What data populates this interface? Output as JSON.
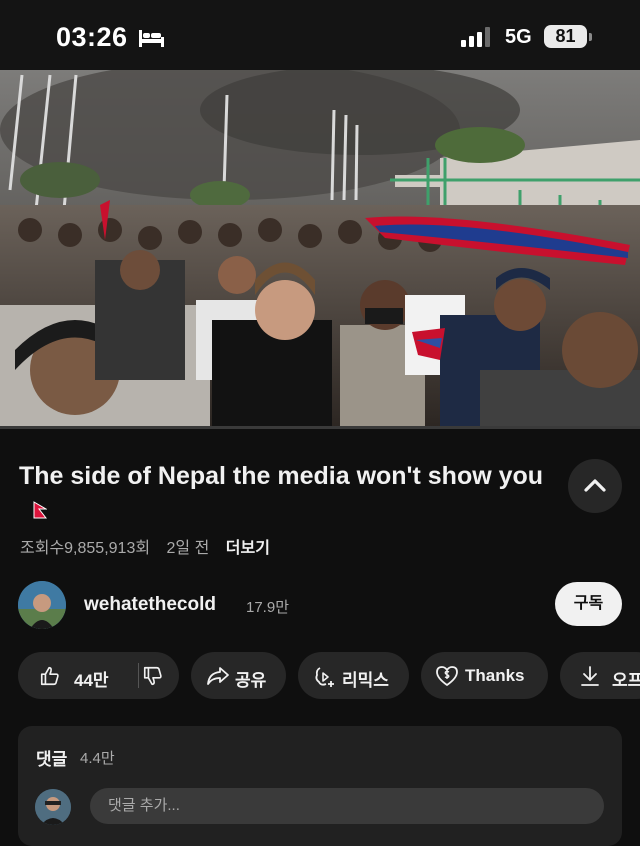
{
  "status_bar": {
    "time": "03:26",
    "network": "5G",
    "battery": "81",
    "icons": [
      "sleep-mode-icon",
      "signal-bars-icon",
      "battery-icon"
    ]
  },
  "video": {
    "thumbnail_description_icon": "video-player",
    "progress": 0
  },
  "info": {
    "title": "The side of Nepal the media won't show you",
    "views": "조회수9,855,913회",
    "age": "2일 전",
    "more": "더보기"
  },
  "channel": {
    "name": "wehatethecold",
    "subscribers": "17.9만",
    "subscribe_label": "구독"
  },
  "actions": {
    "like_count": "44만",
    "share": "공유",
    "remix": "리믹스",
    "thanks": "Thanks",
    "offline": "오프"
  },
  "comments": {
    "title": "댓글",
    "count": "4.4만",
    "placeholder": "댓글 추가..."
  },
  "colors": {
    "background": "#0f0f0f",
    "pill": "#272727",
    "accent": "#ff0033"
  }
}
